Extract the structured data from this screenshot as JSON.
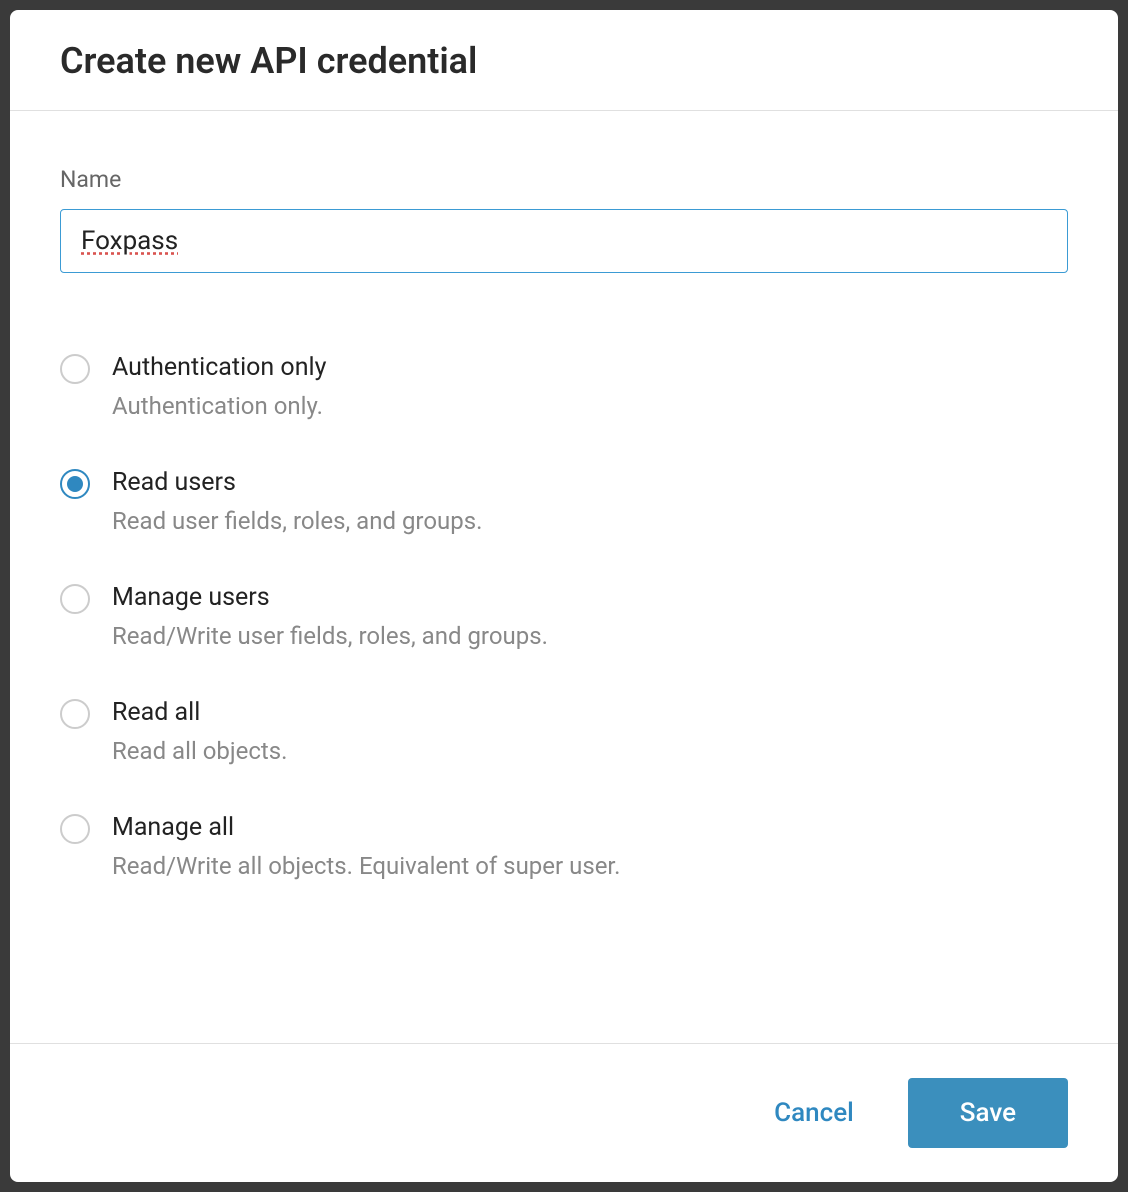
{
  "modal": {
    "title": "Create new API credential",
    "name_field": {
      "label": "Name",
      "value": "Foxpass"
    },
    "options": [
      {
        "label": "Authentication only",
        "description": "Authentication only.",
        "selected": false
      },
      {
        "label": "Read users",
        "description": "Read user fields, roles, and groups.",
        "selected": true
      },
      {
        "label": "Manage users",
        "description": "Read/Write user fields, roles, and groups.",
        "selected": false
      },
      {
        "label": "Read all",
        "description": "Read all objects.",
        "selected": false
      },
      {
        "label": "Manage all",
        "description": "Read/Write all objects. Equivalent of super user.",
        "selected": false
      }
    ],
    "buttons": {
      "cancel": "Cancel",
      "save": "Save"
    }
  }
}
